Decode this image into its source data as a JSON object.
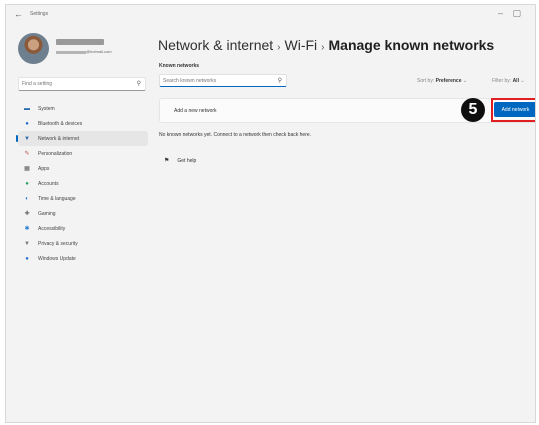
{
  "window": {
    "app_title": "Settings",
    "back_glyph": "←",
    "minimize_glyph": "–",
    "maximize_glyph": "▢"
  },
  "user": {
    "email_suffix": "@hotmail.com"
  },
  "sidebar": {
    "search_placeholder": "Find a setting",
    "items": [
      {
        "label": "System",
        "icon": "monitor-icon",
        "glyph": "▬",
        "color": "#2b6cb0"
      },
      {
        "label": "Bluetooth & devices",
        "icon": "bluetooth-icon",
        "glyph": "●",
        "color": "#1f6fcf"
      },
      {
        "label": "Network & internet",
        "icon": "wifi-icon",
        "glyph": "▼",
        "color": "#2b6cb0",
        "selected": true
      },
      {
        "label": "Personalization",
        "icon": "brush-icon",
        "glyph": "✎",
        "color": "#c05050"
      },
      {
        "label": "Apps",
        "icon": "apps-icon",
        "glyph": "▦",
        "color": "#555555"
      },
      {
        "label": "Accounts",
        "icon": "person-icon",
        "glyph": "●",
        "color": "#2aa060"
      },
      {
        "label": "Time & language",
        "icon": "globe-icon",
        "glyph": "◐",
        "color": "#2a7fd4"
      },
      {
        "label": "Gaming",
        "icon": "gamepad-icon",
        "glyph": "✚",
        "color": "#666666"
      },
      {
        "label": "Accessibility",
        "icon": "accessibility-icon",
        "glyph": "✱",
        "color": "#2a7fd4"
      },
      {
        "label": "Privacy & security",
        "icon": "shield-icon",
        "glyph": "▼",
        "color": "#777777"
      },
      {
        "label": "Windows Update",
        "icon": "update-icon",
        "glyph": "●",
        "color": "#1f6fcf"
      }
    ]
  },
  "breadcrumb": {
    "part1": "Network & internet",
    "part2": "Wi-Fi",
    "current": "Manage known networks",
    "sep": "›"
  },
  "known_networks": {
    "title": "Known networks",
    "search_placeholder": "Search known networks",
    "sort_label": "Sort by:",
    "sort_value": "Preference",
    "filter_label": "Filter by:",
    "filter_value": "All",
    "add_label": "Add a new network",
    "add_button": "Add network",
    "empty_message": "No known networks yet. Connect to a network then check back here.",
    "step_number": "5"
  },
  "help": {
    "label": "Get help"
  },
  "colors": {
    "accent": "#0067c0",
    "highlight": "#e02020"
  }
}
